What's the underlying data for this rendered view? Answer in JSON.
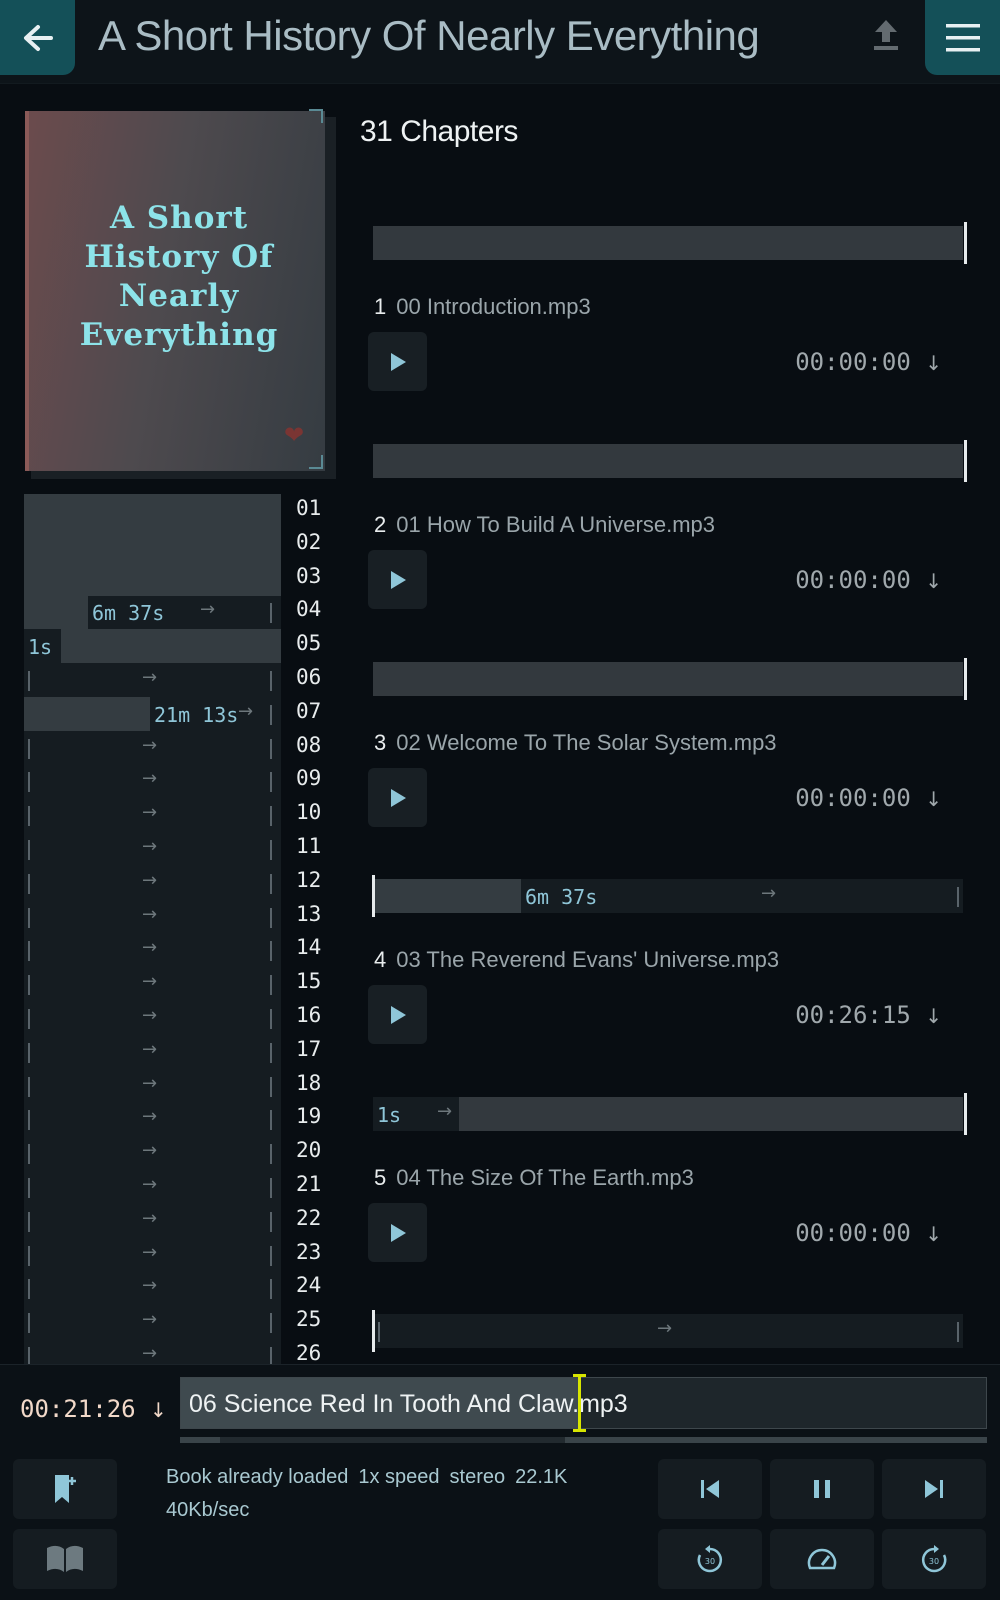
{
  "header": {
    "title": "A Short History Of Nearly Everything",
    "back_icon": "arrow-left-icon",
    "upload_icon": "upload-icon",
    "menu_icon": "hamburger-menu-icon"
  },
  "cover": {
    "title_lines": [
      "A Short",
      "History Of",
      "Nearly",
      "Everything"
    ],
    "heart_icon": "heart-icon"
  },
  "timeline": {
    "labels": {
      "row4": "6m 37s",
      "row5": "1s",
      "row7": "21m 13s"
    },
    "numbers": [
      "01",
      "02",
      "03",
      "04",
      "05",
      "06",
      "07",
      "08",
      "09",
      "10",
      "11",
      "12",
      "13",
      "14",
      "15",
      "16",
      "17",
      "18",
      "19",
      "20",
      "21",
      "22",
      "23",
      "24",
      "25",
      "26"
    ]
  },
  "chapters": {
    "count_label": "31 Chapters",
    "items": [
      {
        "num": "1",
        "name": "00 Introduction.mp3",
        "time": "00:00:00"
      },
      {
        "num": "2",
        "name": "01 How To Build A Universe.mp3",
        "time": "00:00:00"
      },
      {
        "num": "3",
        "name": "02 Welcome To The Solar System.mp3",
        "time": "00:00:00"
      },
      {
        "num": "4",
        "name": "03 The Reverend Evans' Universe.mp3",
        "time": "00:26:15",
        "bar_label": "6m 37s"
      },
      {
        "num": "5",
        "name": "04 The Size Of The Earth.mp3",
        "time": "00:00:00",
        "bar_label": "1s"
      }
    ]
  },
  "player": {
    "current_time": "00:21:26",
    "current_track": "06 Science Red In Tooth And Claw.mp3",
    "progress_fraction": 0.5,
    "status": {
      "loaded": "Book already loaded",
      "speed": "1x speed",
      "channels": "stereo",
      "sample_rate": "22.1K",
      "bitrate": "40Kb/sec"
    },
    "buttons": {
      "add_bookmark_icon": "bookmark-add-icon",
      "book_icon": "open-book-icon",
      "prev_icon": "skip-previous-icon",
      "pause_icon": "pause-icon",
      "next_icon": "skip-next-icon",
      "rewind_icon": "replay-30-icon",
      "speed_icon": "speedometer-icon",
      "forward_icon": "forward-30-icon"
    }
  },
  "colors": {
    "accent": "#145058",
    "cursor": "#d7e500",
    "cover_text": "#8de3e9"
  }
}
